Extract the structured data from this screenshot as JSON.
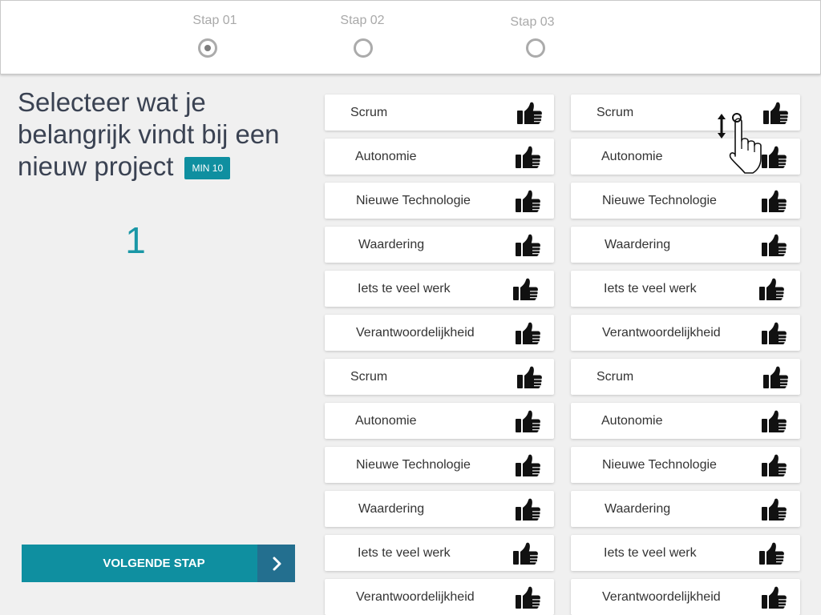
{
  "header": {
    "steps": [
      {
        "label": "Stap 01",
        "selected": true
      },
      {
        "label": "Stap 02",
        "selected": false
      },
      {
        "label": "Stap 03",
        "selected": false
      }
    ]
  },
  "intro": {
    "heading": "Selecteer wat je belangrijk vindt bij een nieuw project",
    "badge": "MIN 10"
  },
  "counter": {
    "value": "1"
  },
  "next_button": {
    "label": "VOLGENDE STAP",
    "icon": "chevron-right-icon"
  },
  "options": {
    "icon": "thumbs-up-icon",
    "columns": [
      {
        "items": [
          "Scrum",
          "Autonomie",
          "Nieuwe Technologie",
          "Waardering",
          "Iets te veel werk",
          "Verantwoordelijkheid",
          "Scrum",
          "Autonomie",
          "Nieuwe Technologie",
          "Waardering",
          "Iets te veel werk",
          "Verantwoordelijkheid"
        ]
      },
      {
        "items": [
          "Scrum",
          "Autonomie",
          "Nieuwe Technologie",
          "Waardering",
          "Iets te veel werk",
          "Verantwoordelijkheid",
          "Scrum",
          "Autonomie",
          "Nieuwe Technologie",
          "Waardering",
          "Iets te veel werk",
          "Verantwoordelijkheid"
        ]
      }
    ]
  },
  "gesture_hint": {
    "icon": "drag-vertical-gesture-icon"
  },
  "colors": {
    "accent": "#0f8fa0",
    "accent_dark": "#236f8f",
    "counter": "#1a97a6",
    "heading": "#3a4252",
    "background": "#f0f0f0"
  }
}
